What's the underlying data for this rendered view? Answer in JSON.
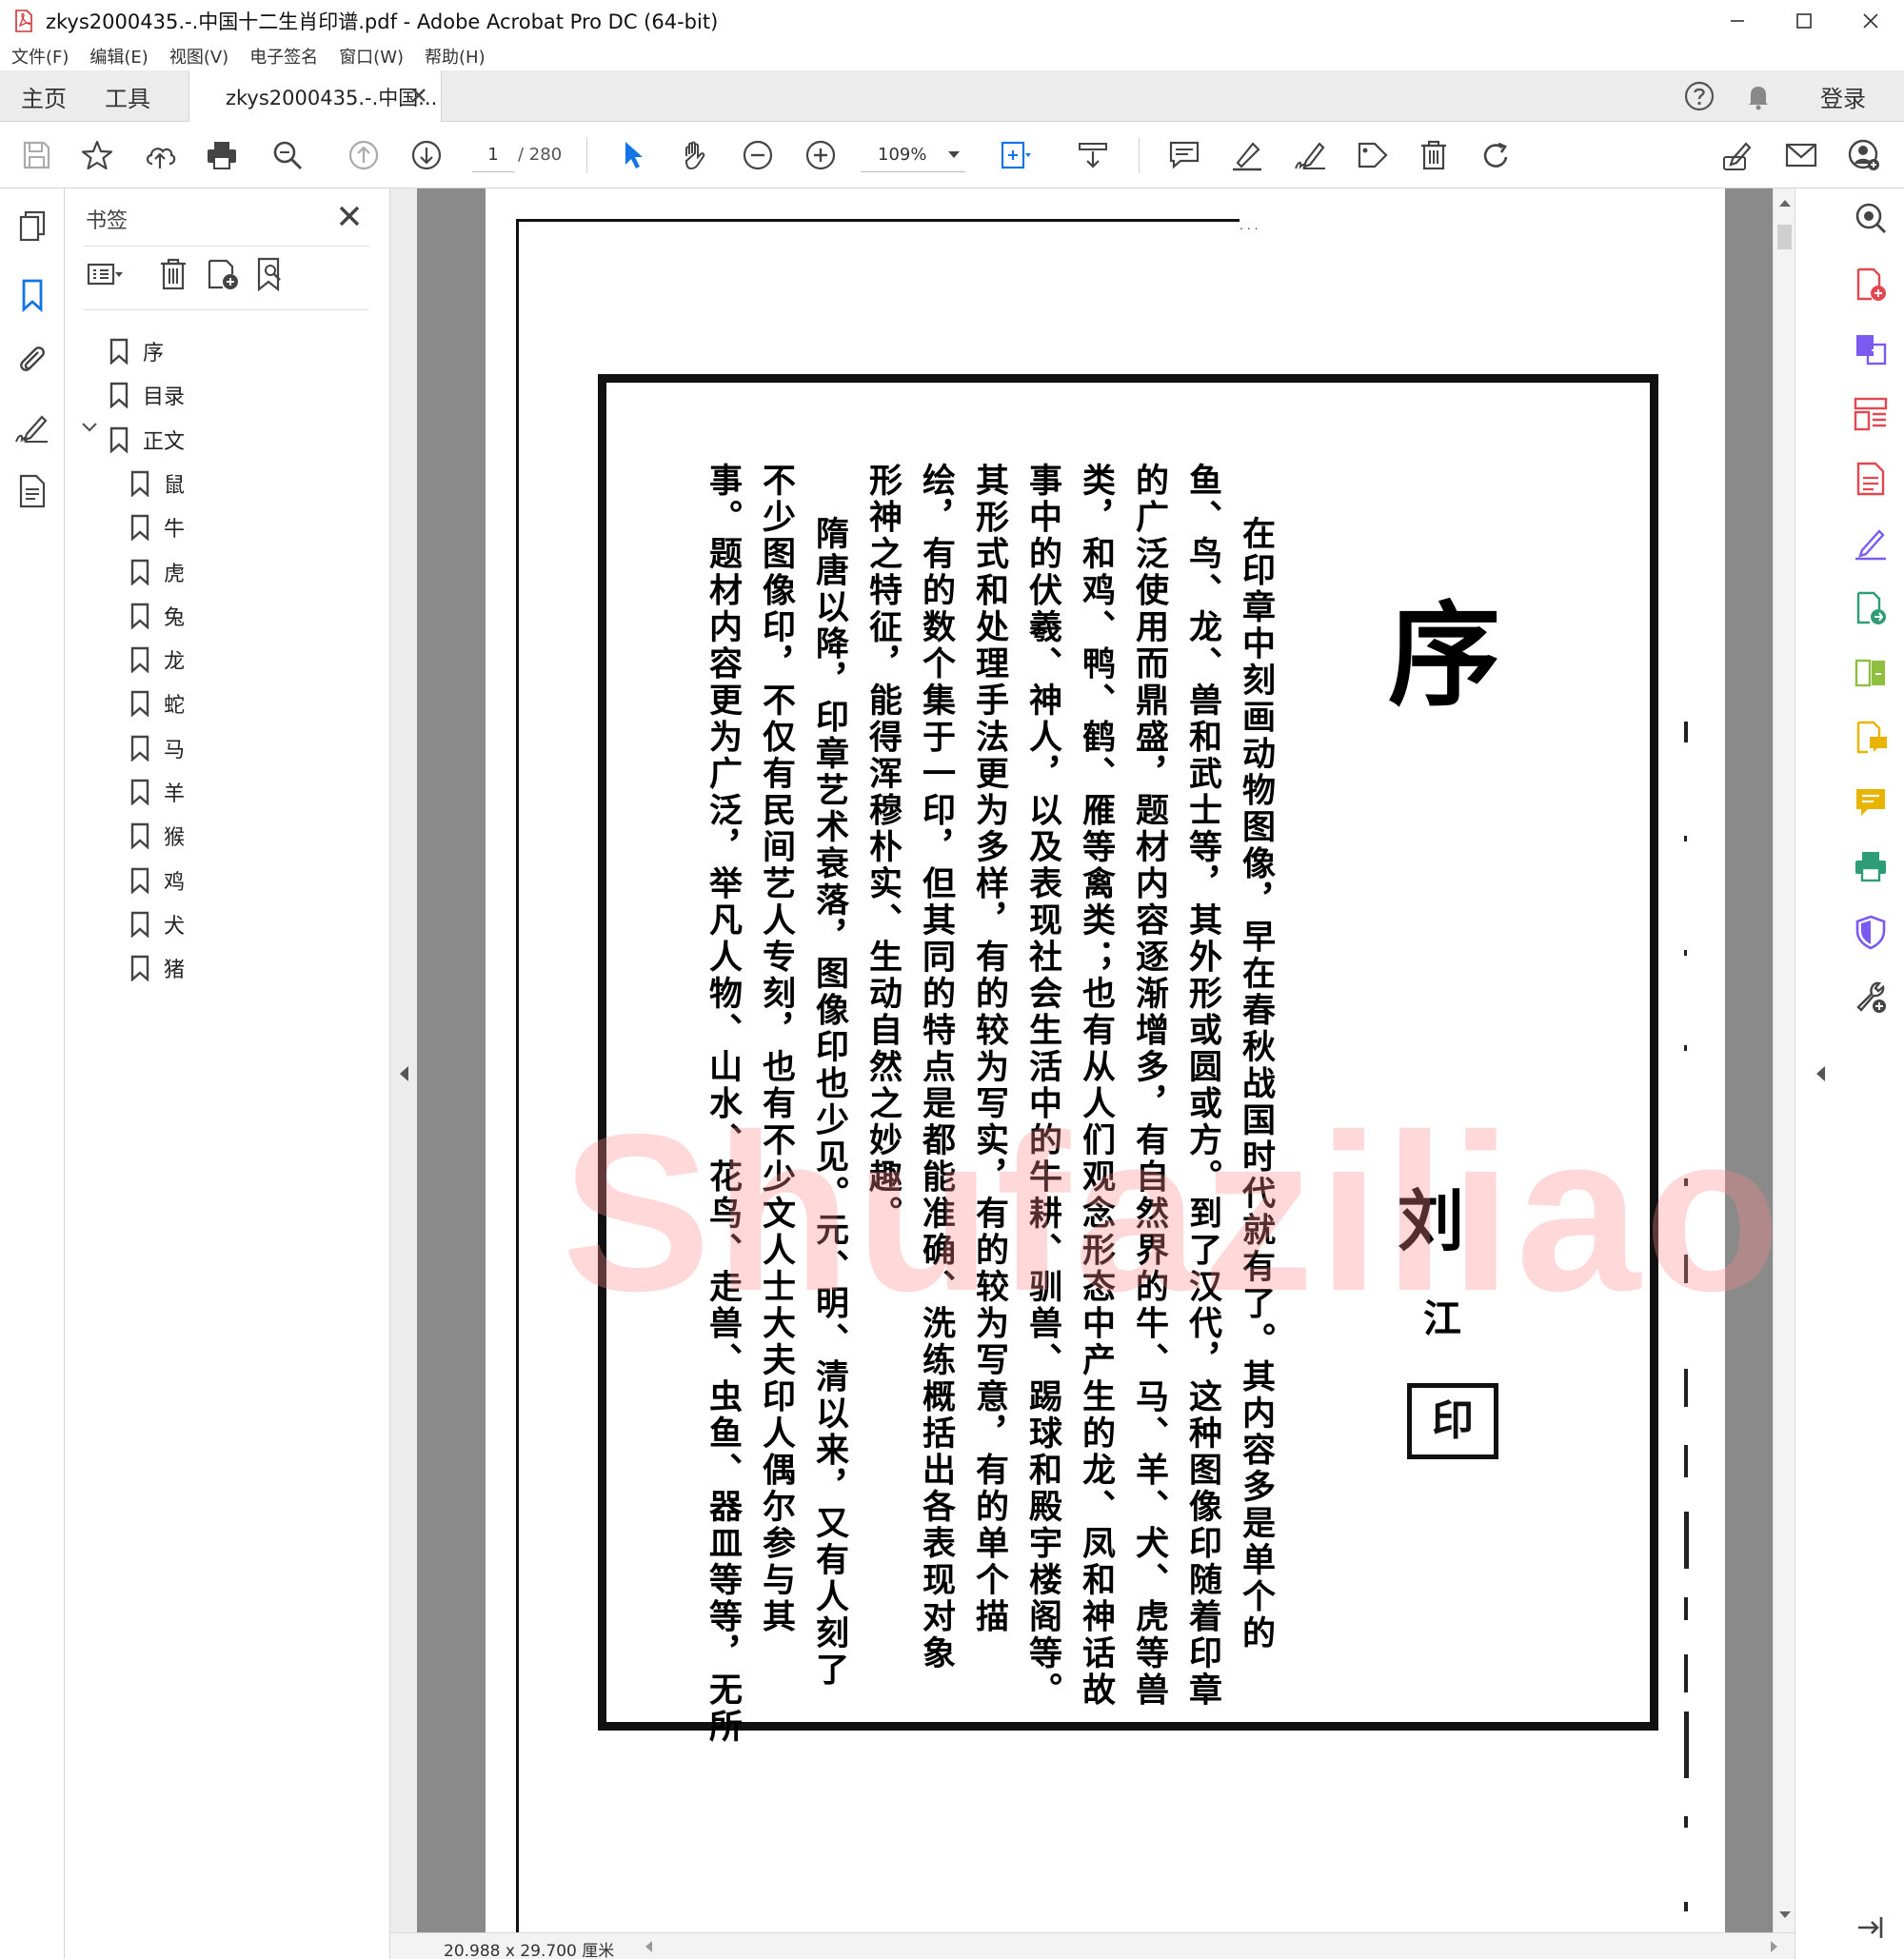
{
  "window": {
    "title": "zkys2000435.-.中国十二生肖印谱.pdf - Adobe Acrobat Pro DC (64-bit)"
  },
  "menu": [
    "文件(F)",
    "编辑(E)",
    "视图(V)",
    "电子签名",
    "窗口(W)",
    "帮助(H)"
  ],
  "tabs": {
    "home": "主页",
    "tools": "工具",
    "document": "zkys2000435.-.中国...",
    "login": "登录"
  },
  "toolbar": {
    "page_current": "1",
    "page_total": "/ 280",
    "zoom": "109%"
  },
  "bookmarks": {
    "title": "书签",
    "items": [
      {
        "label": "序",
        "level": 0
      },
      {
        "label": "目录",
        "level": 0
      },
      {
        "label": "正文",
        "level": 0,
        "expanded": true
      },
      {
        "label": "鼠",
        "level": 1
      },
      {
        "label": "牛",
        "level": 1
      },
      {
        "label": "虎",
        "level": 1
      },
      {
        "label": "兔",
        "level": 1
      },
      {
        "label": "龙",
        "level": 1
      },
      {
        "label": "蛇",
        "level": 1
      },
      {
        "label": "马",
        "level": 1
      },
      {
        "label": "羊",
        "level": 1
      },
      {
        "label": "猴",
        "level": 1
      },
      {
        "label": "鸡",
        "level": 1
      },
      {
        "label": "犬",
        "level": 1
      },
      {
        "label": "猪",
        "level": 1
      }
    ]
  },
  "document_page": {
    "heading": "序",
    "signature": "刘江",
    "seal": "刘江",
    "columns": [
      "在印章中刻画动物图像，早在春秋战国时代就有了。其内容多是单个的",
      "鱼、鸟、龙、兽和武士等，其外形或圆或方。到了汉代，这种图像印随着印章",
      "的广泛使用而鼎盛，题材内容逐渐增多，有自然界的牛、马、羊、犬、虎等兽",
      "类，和鸡、鸭、鹤、雁等禽类；也有从人们观念形态中产生的龙、凤和神话故",
      "事中的伏羲、神人，以及表现社会生活中的牛耕、驯兽、踢球和殿宇楼阁等。",
      "其形式和处理手法更为多样，有的较为写实，有的较为写意，有的单个描",
      "绘，有的数个集于一印，但其同的特点是都能准确、洗练概括出各表现对象",
      "形神之特征，能得浑穆朴实、生动自然之妙趣。",
      "隋唐以降，印章艺术衰落，图像印也少见。元、明、清以来，又有人刻了",
      "不少图像印，不仅有民间艺人专刻，也有不少文人士大夫印人偶尔参与其",
      "事。题材内容更为广泛，举凡人物、山水、花鸟、走兽、虫鱼、器皿等等，无所"
    ]
  },
  "watermark": "Shufaziliao.COM",
  "status": {
    "dimensions": "20.988 x 29.700 厘米"
  },
  "colors": {
    "accent_blue": "#1473e6",
    "tool_red": "#e34850",
    "tool_purple": "#7a5af0",
    "tool_green": "#2d9d78",
    "tool_yellow": "#e8b400",
    "watermark": "#ff8c8c"
  }
}
